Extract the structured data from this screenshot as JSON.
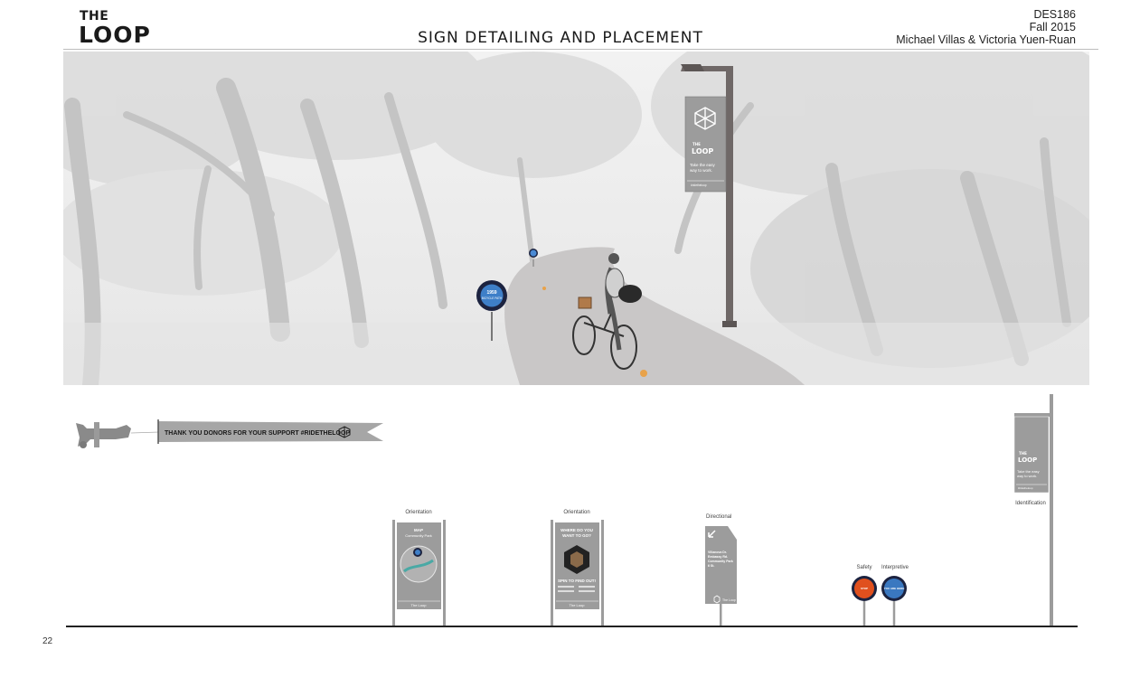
{
  "header": {
    "logo_line1": "THE",
    "logo_line2": "LOOP",
    "title": "SIGN DETAILING AND PLACEMENT",
    "course": "DES186",
    "term": "Fall 2015",
    "authors": "Michael Villas & Victoria Yuen-Ruan"
  },
  "photo": {
    "banner_brand_top": "THE",
    "banner_brand": "LOOP",
    "banner_tagline_1": "Take the easy",
    "banner_tagline_2": "way to work.",
    "banner_hashtag": "#ridetheloop",
    "marker_text_1": "1959",
    "marker_text_2": "BICYCLE PATH"
  },
  "elevation": {
    "plane_banner_text": "THANK YOU DONORS FOR YOUR SUPPORT #RIDETHELOOP",
    "signs": [
      {
        "type": "Orientation",
        "heading_1": "MAP",
        "heading_2": "Community Park",
        "footer": "The Loop"
      },
      {
        "type": "Orientation",
        "heading_1": "WHERE DO YOU",
        "heading_2": "WANT TO GO?",
        "action": "SPIN TO FIND OUT!",
        "footer": "The Loop"
      },
      {
        "type": "Directional",
        "line_1": "Villanova Dr.",
        "line_2": "Embassy Rd.",
        "line_3": "Community Park",
        "line_4": "6 St.",
        "footer": "The Loop"
      },
      {
        "type": "Safety",
        "marker_text": "STOP"
      },
      {
        "type": "Interpretive",
        "marker_text": "YOU ARE HERE"
      },
      {
        "type": "Identification",
        "brand_top": "THE",
        "brand": "LOOP",
        "tagline_1": "Take the easy",
        "tagline_2": "way to work.",
        "hashtag": "#ridetheloop"
      }
    ]
  },
  "page_number": "22",
  "colors": {
    "sign_gray": "#9c9c9c",
    "pole_brown": "#6f6867",
    "safety_orange": "#e0501e",
    "interpretive_blue": "#3a78c0",
    "path_gray": "#c9c7c7"
  }
}
